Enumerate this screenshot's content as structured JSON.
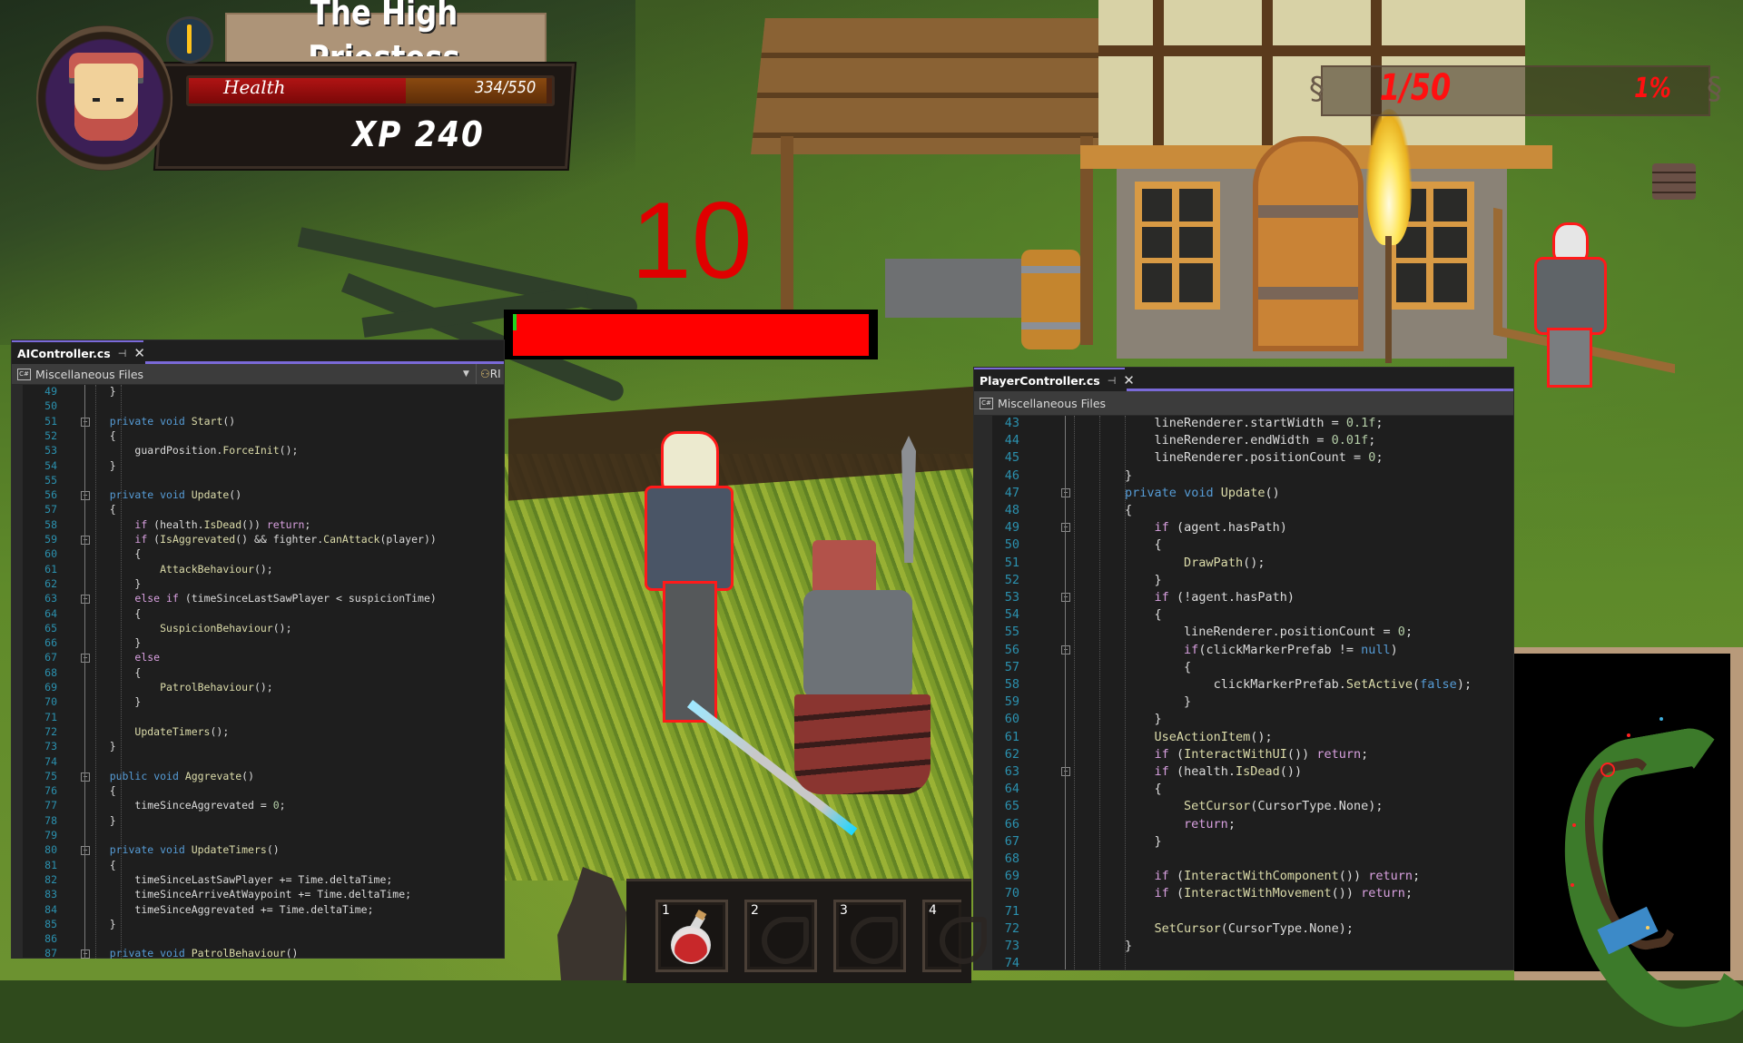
{
  "hud": {
    "character_title": "The High",
    "character_title_line2": "Priestess",
    "health_label": "Health",
    "health_current": 334,
    "health_max": 550,
    "health_text": "334/550",
    "xp_text": "XP  240",
    "xp_value": 240,
    "stat_left_text": "1/50",
    "stat_right_text": "1%",
    "portrait_icon": "hooded-character-portrait",
    "clock_icon": "day-night-clock-icon"
  },
  "combat": {
    "damage_number": "10",
    "enemy_health_fraction": 0.01,
    "colors": {
      "damage": "#e00000",
      "enemy_bar_fill": "#1fd31f",
      "enemy_bar_back": "#ff0000",
      "highlight_outline": "#ff1a1a"
    }
  },
  "hotbar": {
    "slots": [
      {
        "key": "1",
        "item": "health-potion"
      },
      {
        "key": "2",
        "item": "empty"
      },
      {
        "key": "3",
        "item": "empty"
      },
      {
        "key": "4",
        "item": "empty"
      }
    ]
  },
  "minimap": {
    "player_marker_icon": "target-marker-icon"
  },
  "editor_left": {
    "tab_title": "AIController.cs",
    "pin_icon": "pin-icon",
    "close_icon": "close-icon",
    "project_label": "Miscellaneous Files",
    "member_label": "RI",
    "accent": "#7a6ad8",
    "lines": [
      {
        "n": "49",
        "code": "    }"
      },
      {
        "n": "50",
        "code": ""
      },
      {
        "n": "51",
        "code": "    private void Start()",
        "fold": true
      },
      {
        "n": "52",
        "code": "    {"
      },
      {
        "n": "53",
        "code": "        guardPosition.ForceInit();"
      },
      {
        "n": "54",
        "code": "    }"
      },
      {
        "n": "55",
        "code": ""
      },
      {
        "n": "56",
        "code": "    private void Update()",
        "fold": true
      },
      {
        "n": "57",
        "code": "    {"
      },
      {
        "n": "58",
        "code": "        if (health.IsDead()) return;"
      },
      {
        "n": "59",
        "code": "        if (IsAggrevated() && fighter.CanAttack(player))",
        "fold": true
      },
      {
        "n": "60",
        "code": "        {"
      },
      {
        "n": "61",
        "code": "            AttackBehaviour();"
      },
      {
        "n": "62",
        "code": "        }"
      },
      {
        "n": "63",
        "code": "        else if (timeSinceLastSawPlayer < suspicionTime)",
        "fold": true
      },
      {
        "n": "64",
        "code": "        {"
      },
      {
        "n": "65",
        "code": "            SuspicionBehaviour();"
      },
      {
        "n": "66",
        "code": "        }"
      },
      {
        "n": "67",
        "code": "        else",
        "fold": true
      },
      {
        "n": "68",
        "code": "        {"
      },
      {
        "n": "69",
        "code": "            PatrolBehaviour();"
      },
      {
        "n": "70",
        "code": "        }"
      },
      {
        "n": "71",
        "code": ""
      },
      {
        "n": "72",
        "code": "        UpdateTimers();"
      },
      {
        "n": "73",
        "code": "    }"
      },
      {
        "n": "74",
        "code": ""
      },
      {
        "n": "75",
        "code": "    public void Aggrevate()",
        "fold": true
      },
      {
        "n": "76",
        "code": "    {"
      },
      {
        "n": "77",
        "code": "        timeSinceAggrevated = 0;"
      },
      {
        "n": "78",
        "code": "    }"
      },
      {
        "n": "79",
        "code": ""
      },
      {
        "n": "80",
        "code": "    private void UpdateTimers()",
        "fold": true
      },
      {
        "n": "81",
        "code": "    {"
      },
      {
        "n": "82",
        "code": "        timeSinceLastSawPlayer += Time.deltaTime;"
      },
      {
        "n": "83",
        "code": "        timeSinceArriveAtWaypoint += Time.deltaTime;"
      },
      {
        "n": "84",
        "code": "        timeSinceAggrevated += Time.deltaTime;"
      },
      {
        "n": "85",
        "code": "    }"
      },
      {
        "n": "86",
        "code": ""
      },
      {
        "n": "87",
        "code": "    private void PatrolBehaviour()",
        "fold": true
      }
    ]
  },
  "editor_right": {
    "tab_title": "PlayerController.cs",
    "pin_icon": "pin-icon",
    "close_icon": "close-icon",
    "project_label": "Miscellaneous Files",
    "accent": "#7a6ad8",
    "lines": [
      {
        "n": "43",
        "code": "            lineRenderer.startWidth = 0.1f;"
      },
      {
        "n": "44",
        "code": "            lineRenderer.endWidth = 0.01f;"
      },
      {
        "n": "45",
        "code": "            lineRenderer.positionCount = 0;"
      },
      {
        "n": "46",
        "code": "        }"
      },
      {
        "n": "47",
        "code": "        private void Update()",
        "fold": true
      },
      {
        "n": "48",
        "code": "        {"
      },
      {
        "n": "49",
        "code": "            if (agent.hasPath)",
        "fold": true
      },
      {
        "n": "50",
        "code": "            {"
      },
      {
        "n": "51",
        "code": "                DrawPath();"
      },
      {
        "n": "52",
        "code": "            }"
      },
      {
        "n": "53",
        "code": "            if (!agent.hasPath)",
        "fold": true
      },
      {
        "n": "54",
        "code": "            {"
      },
      {
        "n": "55",
        "code": "                lineRenderer.positionCount = 0;"
      },
      {
        "n": "56",
        "code": "                if(clickMarkerPrefab != null)",
        "fold": true
      },
      {
        "n": "57",
        "code": "                {"
      },
      {
        "n": "58",
        "code": "                    clickMarkerPrefab.SetActive(false);"
      },
      {
        "n": "59",
        "code": "                }"
      },
      {
        "n": "60",
        "code": "            }"
      },
      {
        "n": "61",
        "code": "            UseActionItem();"
      },
      {
        "n": "62",
        "code": "            if (InteractWithUI()) return;"
      },
      {
        "n": "63",
        "code": "            if (health.IsDead())",
        "fold": true
      },
      {
        "n": "64",
        "code": "            {"
      },
      {
        "n": "65",
        "code": "                SetCursor(CursorType.None);"
      },
      {
        "n": "66",
        "code": "                return;"
      },
      {
        "n": "67",
        "code": "            }"
      },
      {
        "n": "68",
        "code": ""
      },
      {
        "n": "69",
        "code": "            if (InteractWithComponent()) return;"
      },
      {
        "n": "70",
        "code": "            if (InteractWithMovement()) return;"
      },
      {
        "n": "71",
        "code": ""
      },
      {
        "n": "72",
        "code": "            SetCursor(CursorType.None);"
      },
      {
        "n": "73",
        "code": "        }"
      },
      {
        "n": "74",
        "code": ""
      }
    ]
  }
}
